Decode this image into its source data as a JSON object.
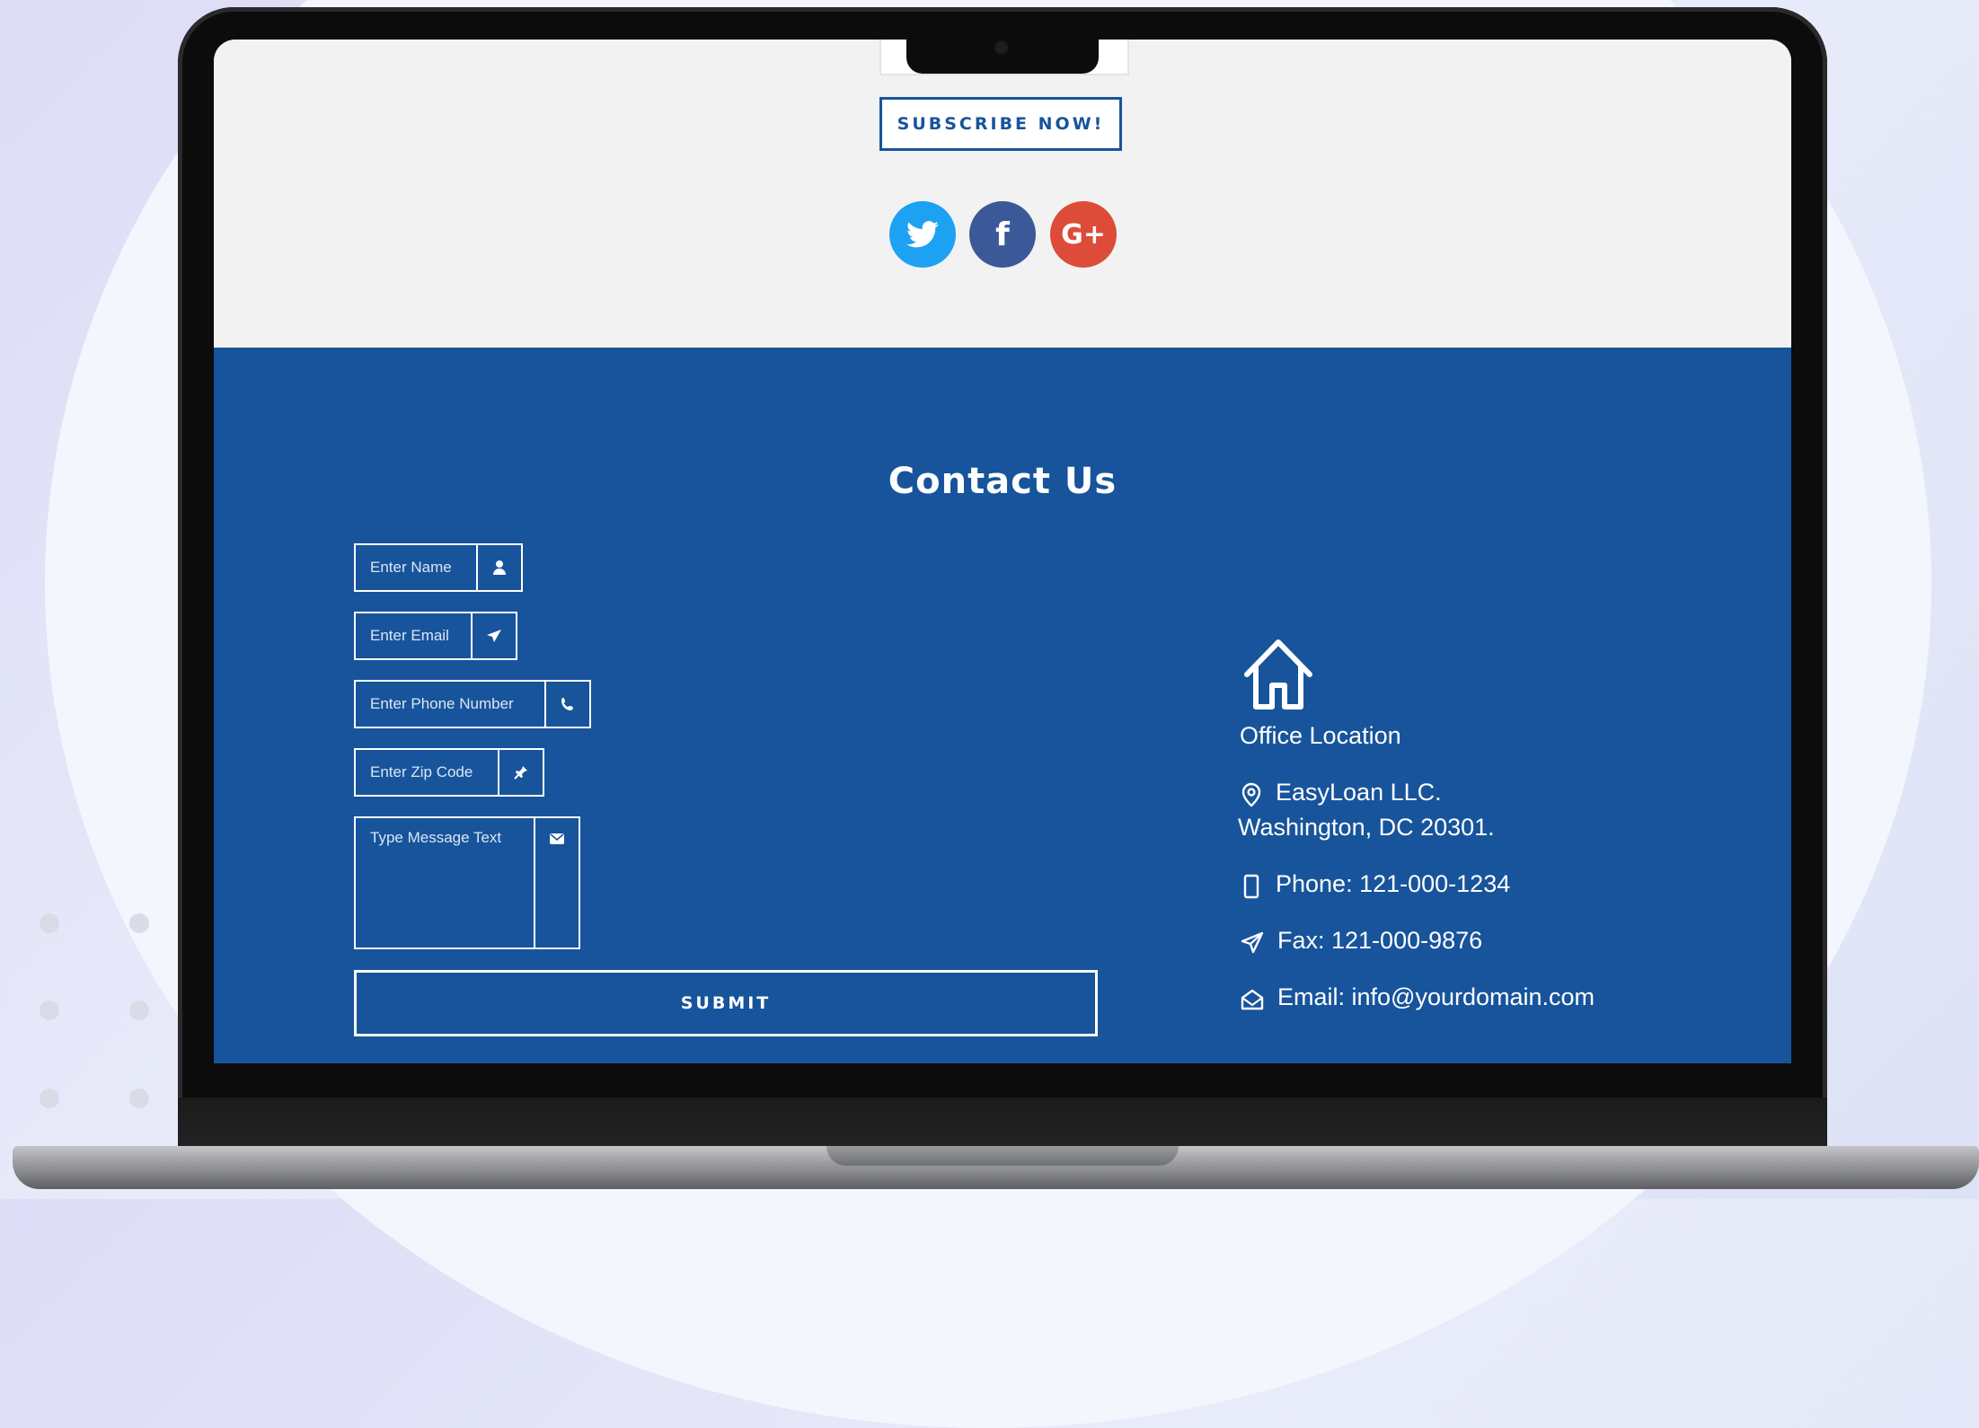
{
  "top": {
    "subscribe_label": "SUBSCRIBE NOW!",
    "social": [
      {
        "name": "twitter",
        "icon": "twitter-icon",
        "color": "#1da1f2"
      },
      {
        "name": "facebook",
        "icon": "facebook-icon",
        "glyph": "f",
        "color": "#3b5998"
      },
      {
        "name": "google-plus",
        "icon": "google-plus-icon",
        "glyph": "G+",
        "color": "#dd4b39"
      }
    ]
  },
  "contact": {
    "title": "Contact Us",
    "form": {
      "name_placeholder": "Enter Name",
      "email_placeholder": "Enter Email",
      "phone_placeholder": "Enter Phone Number",
      "zip_placeholder": "Enter Zip Code",
      "message_placeholder": "Type Message Text",
      "submit_label": "SUBMIT"
    },
    "office": {
      "heading": "Office Location",
      "address_line1": "EasyLoan LLC.",
      "address_line2": "Washington, DC 20301.",
      "phone": "Phone: 121-000-1234",
      "fax": "Fax: 121-000-9876",
      "email": "Email: info@yourdomain.com"
    }
  },
  "colors": {
    "brand_blue": "#17549b",
    "section_bg": "#f2f2f2"
  }
}
